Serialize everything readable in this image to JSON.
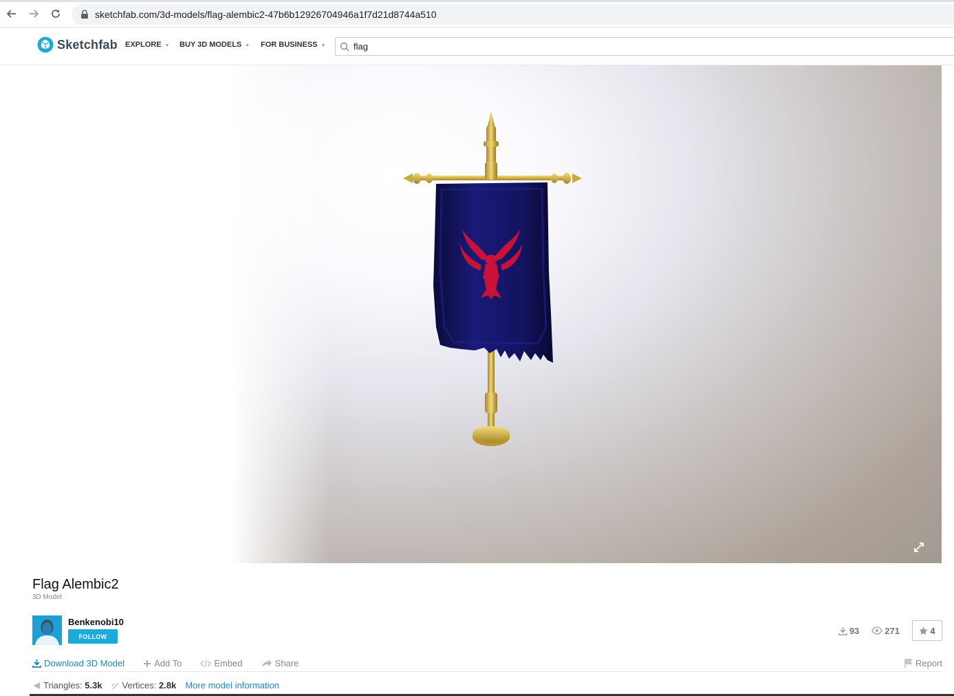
{
  "browser": {
    "url": "sketchfab.com/3d-models/flag-alembic2-47b6b12926704946a1f7d21d8744a510",
    "icons": [
      "back-arrow-icon",
      "forward-arrow-icon",
      "reload-icon",
      "lock-icon"
    ]
  },
  "header": {
    "logo_text": "Sketchfab",
    "menu": [
      "EXPLORE",
      "BUY 3D MODELS",
      "FOR BUSINESS"
    ],
    "search_value": "flag"
  },
  "model": {
    "title": "Flag Alembic2",
    "subtitle": "3D Model"
  },
  "author": {
    "name": "Benkenobi10",
    "follow_label": "FOLLOW"
  },
  "stats": {
    "downloads": "93",
    "views": "271",
    "likes": "4"
  },
  "actions": {
    "download": "Download 3D Model",
    "add_to": "Add To",
    "embed": "Embed",
    "share": "Share",
    "report": "Report"
  },
  "specs": {
    "triangles_label": "Triangles:",
    "triangles_value": "5.3k",
    "vertices_label": "Vertices:",
    "vertices_value": "2.8k",
    "more_info": "More model information"
  },
  "colors": {
    "brand": "#1caad9",
    "link": "#1c88bc",
    "flag_cloth": "#14146a",
    "phoenix": "#c8123a",
    "gold": "#c9a93a"
  }
}
